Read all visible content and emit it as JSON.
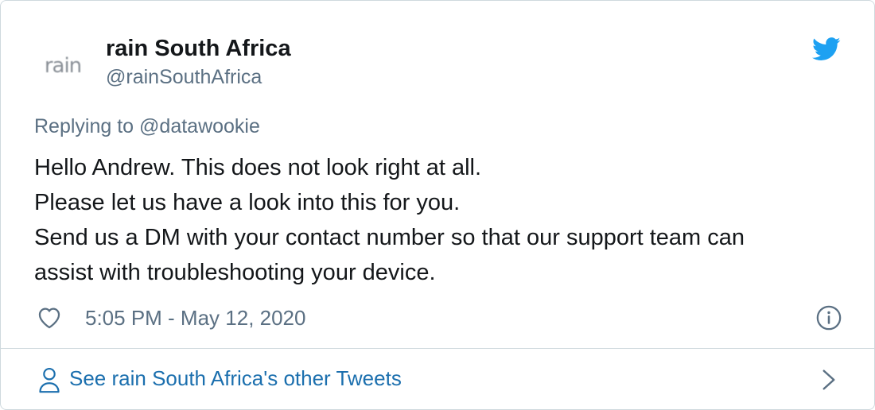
{
  "author": {
    "avatar_text": "rain",
    "name": "rain South Africa",
    "handle": "@rainSouthAfrica"
  },
  "reply": {
    "prefix": "Replying to ",
    "mention": "@datawookie"
  },
  "tweet": {
    "lines": [
      "Hello Andrew. This does not look right at all.",
      "Please let us have a look into this for you.",
      "Send us a DM with your contact number so that our support team can",
      "assist with troubleshooting your device."
    ]
  },
  "meta": {
    "timestamp": "5:05 PM - May 12, 2020"
  },
  "footer": {
    "link_text": "See rain South Africa's other Tweets"
  },
  "icons": {
    "logo": "twitter-bird-icon",
    "like": "heart-icon",
    "info": "info-icon",
    "person": "person-icon",
    "chevron": "chevron-right-icon"
  },
  "colors": {
    "twitter_blue": "#1da1f2",
    "link": "#1b6fae",
    "text": "#14171a",
    "muted": "#5b7083",
    "border": "#cfd9de"
  }
}
